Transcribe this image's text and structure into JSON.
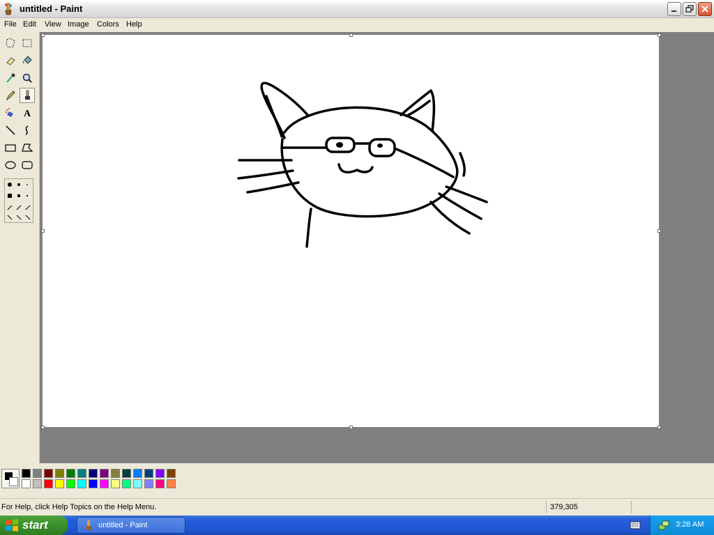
{
  "window": {
    "title": "untitled - Paint"
  },
  "menubar": {
    "items": [
      "File",
      "Edit",
      "View",
      "Image",
      "Colors",
      "Help"
    ]
  },
  "tools": [
    {
      "name": "free-form-select-tool",
      "icon": "free-form-select-icon",
      "selected": false
    },
    {
      "name": "rect-select-tool",
      "icon": "rect-select-icon",
      "selected": false
    },
    {
      "name": "eraser-tool",
      "icon": "eraser-icon",
      "selected": false
    },
    {
      "name": "fill-tool",
      "icon": "fill-bucket-icon",
      "selected": false
    },
    {
      "name": "pick-color-tool",
      "icon": "eyedropper-icon",
      "selected": false
    },
    {
      "name": "magnifier-tool",
      "icon": "magnifier-icon",
      "selected": false
    },
    {
      "name": "pencil-tool",
      "icon": "pencil-icon",
      "selected": false
    },
    {
      "name": "brush-tool",
      "icon": "brush-icon",
      "selected": true
    },
    {
      "name": "airbrush-tool",
      "icon": "airbrush-icon",
      "selected": false
    },
    {
      "name": "text-tool",
      "icon": "text-icon",
      "selected": false
    },
    {
      "name": "line-tool",
      "icon": "line-icon",
      "selected": false
    },
    {
      "name": "curve-tool",
      "icon": "curve-icon",
      "selected": false
    },
    {
      "name": "rectangle-tool",
      "icon": "rectangle-icon",
      "selected": false
    },
    {
      "name": "polygon-tool",
      "icon": "polygon-icon",
      "selected": false
    },
    {
      "name": "ellipse-tool",
      "icon": "ellipse-icon",
      "selected": false
    },
    {
      "name": "rounded-rect-tool",
      "icon": "rounded-rect-icon",
      "selected": false
    }
  ],
  "colors": {
    "foreground": "#000000",
    "background": "#ffffff",
    "palette_top": [
      "#000000",
      "#808080",
      "#800000",
      "#808000",
      "#008000",
      "#008080",
      "#000080",
      "#800080",
      "#808040",
      "#004040",
      "#0080ff",
      "#004080",
      "#8000ff",
      "#804000"
    ],
    "palette_bottom": [
      "#ffffff",
      "#c0c0c0",
      "#ff0000",
      "#ffff00",
      "#00ff00",
      "#00ffff",
      "#0000ff",
      "#ff00ff",
      "#ffff80",
      "#00ff80",
      "#80ffff",
      "#8080ff",
      "#ff0080",
      "#ff8040"
    ]
  },
  "status": {
    "help": "For Help, click Help Topics on the Help Menu.",
    "coords": "379,305"
  },
  "taskbar": {
    "start_label": "start",
    "task_label": "untitled - Paint",
    "clock": "3:28 AM"
  }
}
